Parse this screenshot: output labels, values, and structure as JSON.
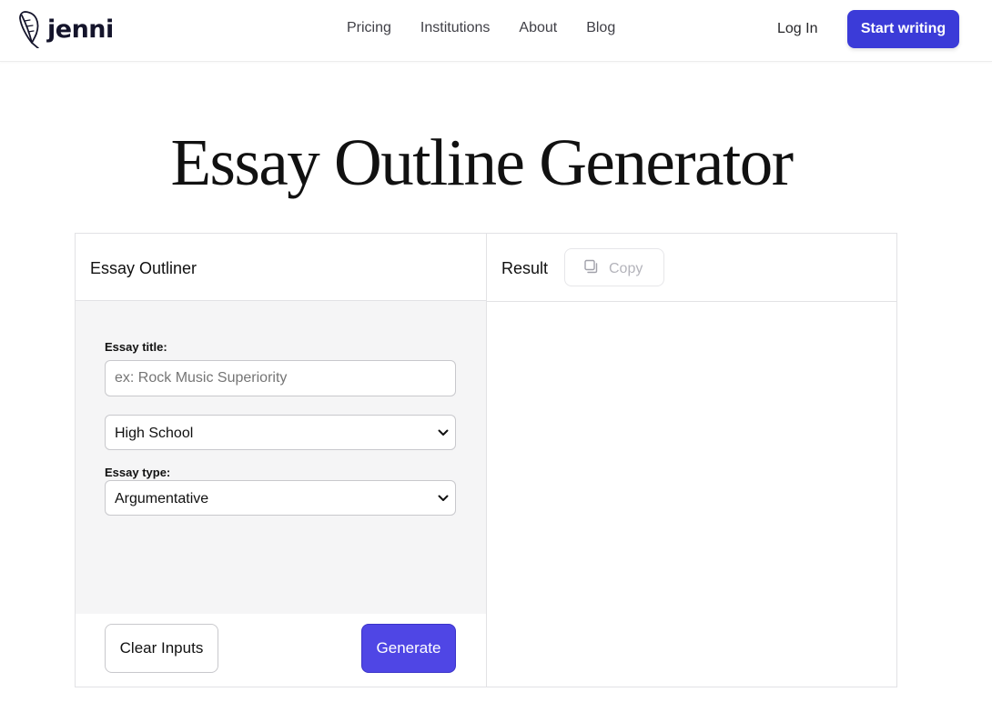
{
  "brand": {
    "name": "jenni",
    "accent_color": "#3b3bd8"
  },
  "nav": {
    "links": [
      "Pricing",
      "Institutions",
      "About",
      "Blog"
    ],
    "login_label": "Log In",
    "cta_label": "Start writing"
  },
  "page": {
    "title": "Essay Outline Generator"
  },
  "input_panel": {
    "header": "Essay Outliner",
    "essay_title_label": "Essay title:",
    "essay_title_value": "",
    "essay_title_placeholder": "ex: Rock Music Superiority",
    "level_select": {
      "selected": "High School"
    },
    "essay_type_label": "Essay type:",
    "type_select": {
      "selected": "Argumentative"
    },
    "clear_label": "Clear Inputs",
    "generate_label": "Generate",
    "generate_color": "#4f46e5"
  },
  "result_panel": {
    "header": "Result",
    "copy_label": "Copy",
    "copy_icon": "copy-icon",
    "content": ""
  },
  "icons": {
    "logo": "quill-pen-icon",
    "select_arrow": "chevron-down-icon"
  }
}
